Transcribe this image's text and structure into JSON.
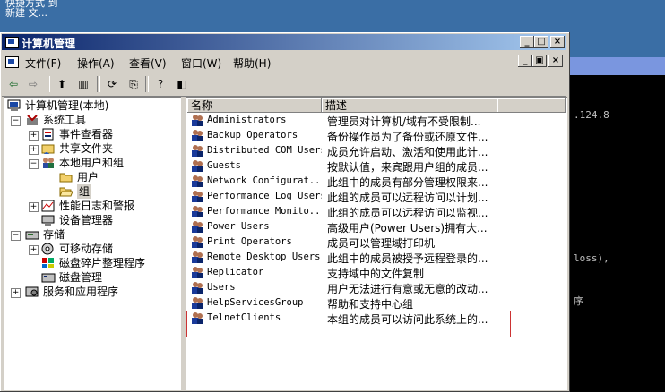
{
  "desktop": {
    "line1": "快捷方式 到",
    "line2": "新建 文..."
  },
  "console": {
    "line1": ".124.8",
    "line2": "loss),",
    "line3": "序"
  },
  "window": {
    "title": "计算机管理"
  },
  "menu": [
    {
      "label": "文件(F)"
    },
    {
      "label": "操作(A)"
    },
    {
      "label": "查看(V)"
    },
    {
      "label": "窗口(W)"
    },
    {
      "label": "帮助(H)"
    }
  ],
  "tree": [
    {
      "label": "计算机管理(本地)"
    },
    {
      "label": "系统工具"
    },
    {
      "label": "事件查看器"
    },
    {
      "label": "共享文件夹"
    },
    {
      "label": "本地用户和组"
    },
    {
      "label": "用户"
    },
    {
      "label": "组"
    },
    {
      "label": "性能日志和警报"
    },
    {
      "label": "设备管理器"
    },
    {
      "label": "存储"
    },
    {
      "label": "可移动存储"
    },
    {
      "label": "磁盘碎片整理程序"
    },
    {
      "label": "磁盘管理"
    },
    {
      "label": "服务和应用程序"
    }
  ],
  "columns": {
    "name": "名称",
    "desc": "描述"
  },
  "groups": [
    {
      "name": "Administrators",
      "desc": "管理员对计算机/域有不受限制..."
    },
    {
      "name": "Backup Operators",
      "desc": "备份操作员为了备份或还原文件..."
    },
    {
      "name": "Distributed COM Users",
      "desc": "成员允许启动、激活和使用此计..."
    },
    {
      "name": "Guests",
      "desc": "按默认值，来宾跟用户组的成员..."
    },
    {
      "name": "Network Configurat...",
      "desc": "此组中的成员有部分管理权限来..."
    },
    {
      "name": "Performance Log Users",
      "desc": "此组的成员可以远程访问以计划..."
    },
    {
      "name": "Performance Monito...",
      "desc": "此组的成员可以远程访问以监视..."
    },
    {
      "name": "Power Users",
      "desc": "高级用户(Power Users)拥有大..."
    },
    {
      "name": "Print Operators",
      "desc": "成员可以管理域打印机"
    },
    {
      "name": "Remote Desktop Users",
      "desc": "此组中的成员被授予远程登录的..."
    },
    {
      "name": "Replicator",
      "desc": "支持域中的文件复制"
    },
    {
      "name": "Users",
      "desc": "用户无法进行有意或无意的改动..."
    },
    {
      "name": "HelpServicesGroup",
      "desc": "帮助和支持中心组"
    },
    {
      "name": "TelnetClients",
      "desc": "本组的成员可以访问此系统上的..."
    }
  ]
}
